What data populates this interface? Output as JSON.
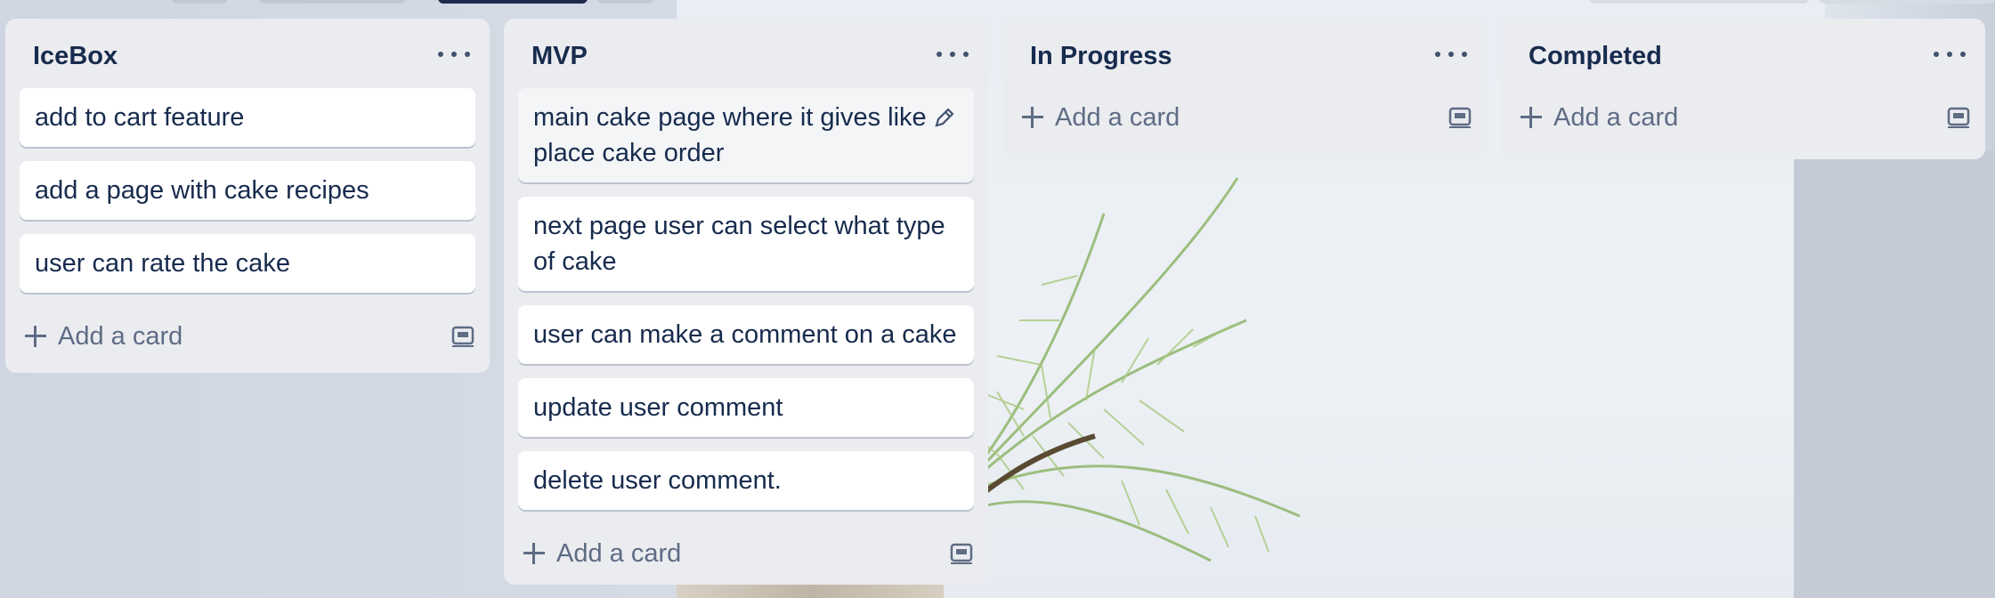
{
  "lists": [
    {
      "title": "IceBox",
      "cards": [
        "add to cart feature",
        "add a page with cake recipes",
        "user can rate the cake"
      ],
      "add_label": "Add a card"
    },
    {
      "title": "MVP",
      "cards": [
        "main cake page where it gives like t place cake order",
        "next page user can select what type of cake",
        "user can make a comment on a cake",
        "update user comment",
        "delete user comment."
      ],
      "card_first_line": "main cake page where it gives like",
      "card_first_line_2": "place cake order",
      "add_label": "Add a card"
    },
    {
      "title": "In Progress",
      "cards": [],
      "add_label": "Add a card"
    },
    {
      "title": "Completed",
      "cards": [],
      "add_label": "Add a card"
    }
  ],
  "icons": {
    "list_menu": "ellipsis-icon",
    "add": "plus-icon",
    "template": "card-template-icon",
    "edit": "pencil-icon"
  },
  "colors": {
    "list_bg": "#ebecf0",
    "card_bg": "#ffffff",
    "title_text": "#172b4d",
    "muted_text": "#5e6c84"
  }
}
